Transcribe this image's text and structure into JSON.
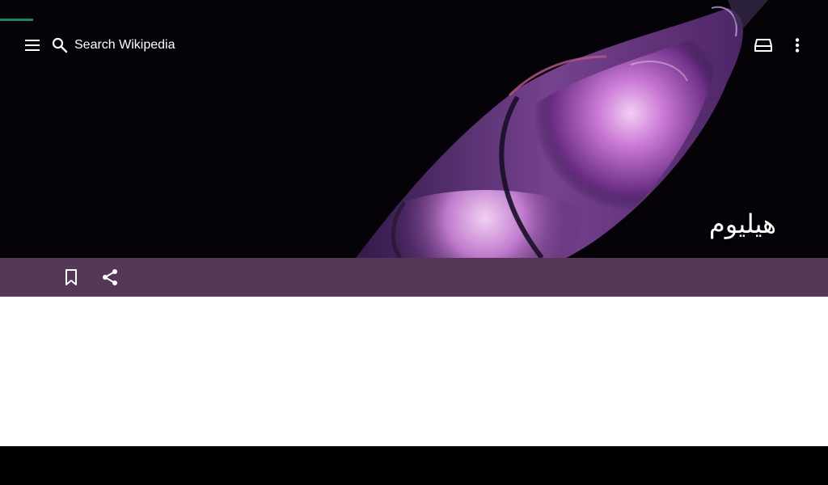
{
  "app": {
    "name": "Wikipedia"
  },
  "colors": {
    "progress": "#14866d",
    "action_bar": "#543856",
    "toolbar_icons": "#ffffff",
    "content_bg": "#ffffff"
  },
  "load_progress": 0.04,
  "toolbar": {
    "menu_icon": "hamburger-menu-icon",
    "search_icon": "magnifier-icon",
    "search_placeholder": "Search Wikipedia",
    "tabs_icon": "tabs-icon",
    "overflow_icon": "more-vert-icon"
  },
  "article": {
    "title": "هيليوم",
    "lead_image": "helium discharge tube glowing purple"
  },
  "actions": {
    "bookmark_icon": "bookmark-icon",
    "share_icon": "share-icon"
  }
}
